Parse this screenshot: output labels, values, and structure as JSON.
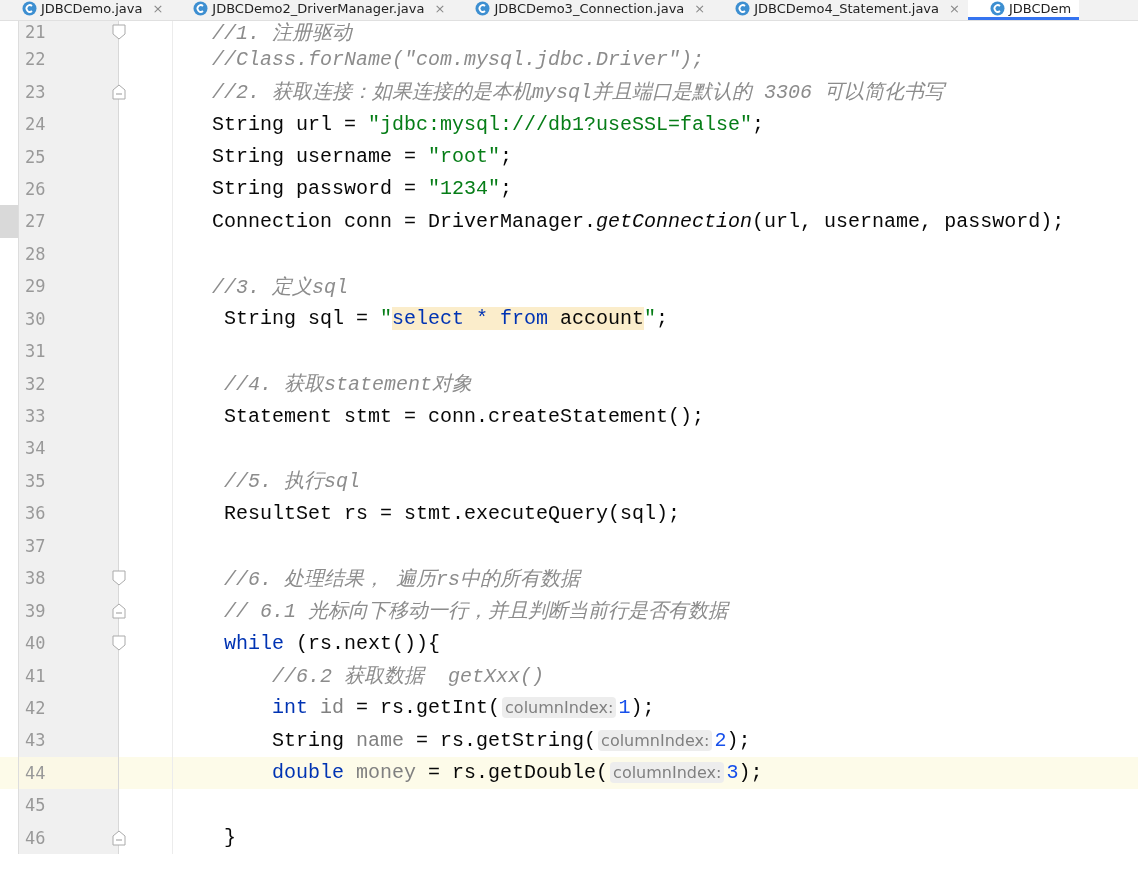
{
  "tabs": [
    {
      "label": "JDBCDemo.java",
      "selected": false,
      "close": "×"
    },
    {
      "label": "JDBCDemo2_DriverManager.java",
      "selected": false,
      "close": "×"
    },
    {
      "label": "JDBCDemo3_Connection.java",
      "selected": false,
      "close": "×"
    },
    {
      "label": "JDBCDemo4_Statement.java",
      "selected": false,
      "close": "×"
    },
    {
      "label": "JDBCDem",
      "selected": true
    }
  ],
  "lines": [
    {
      "number": "21",
      "fold_start": true,
      "tokens": [
        {
          "kind": "comment",
          "text": "//1. 注册驱动"
        }
      ]
    },
    {
      "number": "22",
      "tokens": [
        {
          "kind": "comment",
          "text": "//Class.forName(\"com.mysql.jdbc.Driver\");"
        }
      ]
    },
    {
      "number": "23",
      "fold_end": true,
      "tokens": [
        {
          "kind": "comment",
          "text": "//2. 获取连接：如果连接的是本机mysql并且端口是默认的 3306 可以简化书写"
        }
      ]
    },
    {
      "number": "24",
      "tokens": [
        {
          "kind": "plain",
          "text": "String url = "
        },
        {
          "kind": "string",
          "text": "\"jdbc:mysql:///db1?useSSL=false\""
        },
        {
          "kind": "plain",
          "text": ";"
        }
      ]
    },
    {
      "number": "25",
      "tokens": [
        {
          "kind": "plain",
          "text": "String username = "
        },
        {
          "kind": "string",
          "text": "\"root\""
        },
        {
          "kind": "plain",
          "text": ";"
        }
      ]
    },
    {
      "number": "26",
      "tokens": [
        {
          "kind": "plain",
          "text": "String password = "
        },
        {
          "kind": "string",
          "text": "\"1234\""
        },
        {
          "kind": "plain",
          "text": ";"
        }
      ]
    },
    {
      "number": "27",
      "marked": true,
      "tokens": [
        {
          "kind": "plain",
          "text": "Connection conn = DriverManager."
        },
        {
          "kind": "static",
          "text": "getConnection"
        },
        {
          "kind": "plain",
          "text": "(url, username, password);"
        }
      ]
    },
    {
      "number": "28"
    },
    {
      "number": "29",
      "tokens": [
        {
          "kind": "comment",
          "text": "//3. 定义sql"
        }
      ]
    },
    {
      "number": "30",
      "tokens": [
        {
          "kind": "plain",
          "text": " String sql = "
        },
        {
          "kind": "string",
          "text": "\""
        },
        {
          "kind": "sql-keyword",
          "text": "select * from"
        },
        {
          "kind": "sql",
          "text": " account"
        },
        {
          "kind": "string",
          "text": "\""
        },
        {
          "kind": "plain",
          "text": ";"
        }
      ]
    },
    {
      "number": "31"
    },
    {
      "number": "32",
      "tokens": [
        {
          "kind": "comment",
          "text": " //4. 获取statement对象"
        }
      ]
    },
    {
      "number": "33",
      "tokens": [
        {
          "kind": "plain",
          "text": " Statement stmt = conn.createStatement();"
        }
      ]
    },
    {
      "number": "34"
    },
    {
      "number": "35",
      "tokens": [
        {
          "kind": "comment",
          "text": " //5. 执行sql"
        }
      ]
    },
    {
      "number": "36",
      "tokens": [
        {
          "kind": "plain",
          "text": " ResultSet rs = stmt.executeQuery(sql);"
        }
      ]
    },
    {
      "number": "37"
    },
    {
      "number": "38",
      "fold_start": true,
      "tokens": [
        {
          "kind": "comment",
          "text": " //6. 处理结果， 遍历rs中的所有数据"
        }
      ]
    },
    {
      "number": "39",
      "fold_end": true,
      "tokens": [
        {
          "kind": "comment",
          "text": " // 6.1 光标向下移动一行，并且判断当前行是否有数据"
        }
      ]
    },
    {
      "number": "40",
      "fold_start": true,
      "tokens": [
        {
          "kind": "keyword",
          "text": " while"
        },
        {
          "kind": "plain",
          "text": " (rs.next()){"
        }
      ]
    },
    {
      "number": "41",
      "tokens": [
        {
          "kind": "comment",
          "text": "     //6.2 获取数据  getXxx()"
        }
      ]
    },
    {
      "number": "42",
      "tokens": [
        {
          "kind": "keyword",
          "text": "     int"
        },
        {
          "kind": "unused",
          "text": " id"
        },
        {
          "kind": "plain",
          "text": " = rs.getInt("
        },
        {
          "kind": "hint",
          "text": "columnIndex:"
        },
        {
          "kind": "number",
          "text": "1"
        },
        {
          "kind": "plain",
          "text": ");"
        }
      ]
    },
    {
      "number": "43",
      "tokens": [
        {
          "kind": "plain",
          "text": "     String"
        },
        {
          "kind": "unused",
          "text": " name"
        },
        {
          "kind": "plain",
          "text": " = rs.getString("
        },
        {
          "kind": "hint",
          "text": "columnIndex:"
        },
        {
          "kind": "number",
          "text": "2"
        },
        {
          "kind": "plain",
          "text": ");"
        }
      ]
    },
    {
      "number": "44",
      "current": true,
      "tokens": [
        {
          "kind": "keyword",
          "text": "     double"
        },
        {
          "kind": "unused",
          "text": " money"
        },
        {
          "kind": "plain",
          "text": " = rs.getDouble("
        },
        {
          "kind": "hint",
          "text": "columnIndex:"
        },
        {
          "kind": "number",
          "text": "3"
        },
        {
          "kind": "plain",
          "text": ");"
        }
      ]
    },
    {
      "number": "45"
    },
    {
      "number": "46",
      "fold_end": true,
      "tokens": [
        {
          "kind": "plain",
          "text": " }"
        }
      ]
    }
  ]
}
